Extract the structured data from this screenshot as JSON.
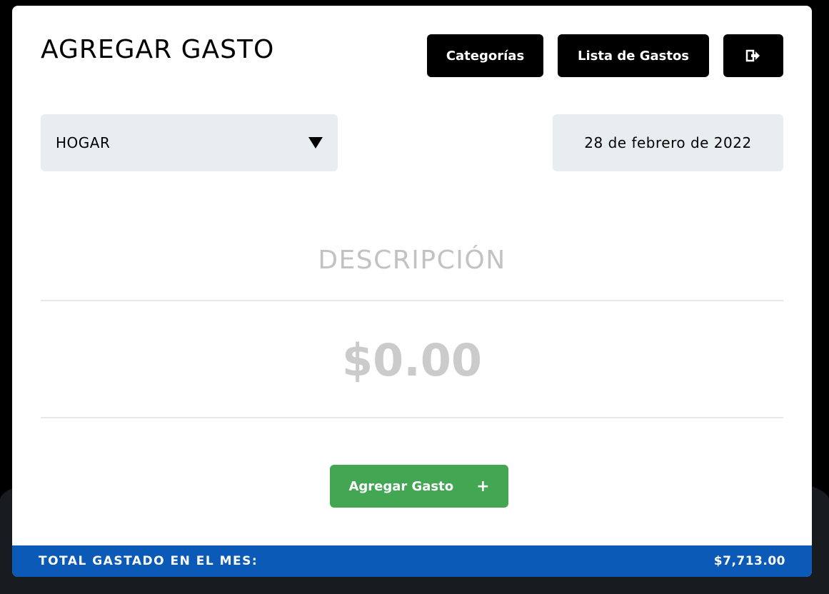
{
  "header": {
    "title": "AGREGAR GASTO",
    "buttons": {
      "categories_label": "Categorías",
      "expense_list_label": "Lista de Gastos",
      "logout_icon": "logout-icon"
    }
  },
  "form": {
    "category": {
      "selected": "HOGAR",
      "icon": "triangle-down-icon"
    },
    "date": {
      "value": "28 de febrero de 2022"
    },
    "description": {
      "placeholder": "DESCRIPCIÓN"
    },
    "amount": {
      "placeholder": "$0.00"
    },
    "submit": {
      "label": "Agregar Gasto",
      "icon": "+"
    }
  },
  "footer": {
    "label": "TOTAL GASTADO EN EL MES:",
    "total": "$7,713.00"
  },
  "colors": {
    "primary_button": "#000000",
    "submit_button": "#42a653",
    "footer_bar": "#0b5ab7",
    "input_background": "#e8eef0",
    "placeholder_text": "#c2c2c2"
  }
}
